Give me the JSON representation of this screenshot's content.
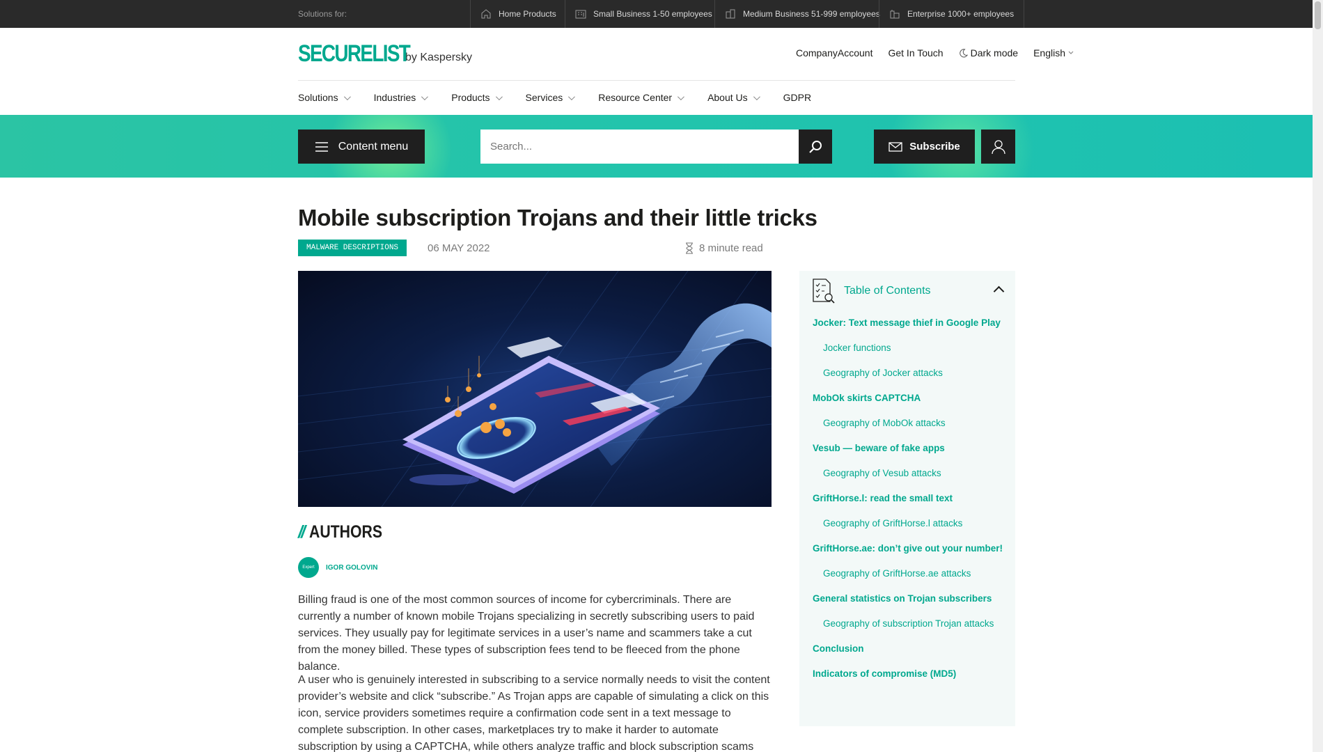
{
  "topbar": {
    "label": "Solutions for:",
    "segments": [
      {
        "label": "Home Products",
        "icon": "home-icon"
      },
      {
        "label": "Small Business 1-50 employees",
        "icon": "building-icon"
      },
      {
        "label": "Medium Business 51-999 employees",
        "icon": "buildings-icon"
      },
      {
        "label": "Enterprise 1000+ employees",
        "icon": "enterprise-icon"
      }
    ]
  },
  "header": {
    "logo_mark": "SECURELIST",
    "logo_by": "by Kaspersky",
    "links": {
      "company_account": "CompanyAccount",
      "get_in_touch": "Get In Touch",
      "dark_mode": "Dark mode",
      "language": "English"
    },
    "nav": [
      "Solutions",
      "Industries",
      "Products",
      "Services",
      "Resource Center",
      "About Us",
      "GDPR"
    ]
  },
  "band": {
    "content_menu": "Content menu",
    "search_placeholder": "Search...",
    "subscribe": "Subscribe"
  },
  "article": {
    "title": "Mobile subscription Trojans and their little tricks",
    "tag": "MALWARE DESCRIPTIONS",
    "date": "06 MAY 2022",
    "read_time": "8 minute read",
    "authors_slashes": "//",
    "authors_heading": "AUTHORS",
    "author_badge": "Expert",
    "author_name": "IGOR GOLOVIN",
    "paragraphs": [
      "Billing fraud is one of the most common sources of income for cybercriminals. There are currently a number of known mobile Trojans specializing in secretly subscribing users to paid services. They usually pay for legitimate services in a user’s name and scammers take a cut from the money billed. These types of subscription fees tend to be fleeced from the phone balance.",
      "A user who is genuinely interested in subscribing to a service normally needs to visit the content provider’s website and click “subscribe.” As Trojan apps are capable of simulating a click on this icon, service providers sometimes require a confirmation code sent in a text message to complete subscription. In other cases, marketplaces try to make it harder to automate subscription by using a CAPTCHA, while others analyze traffic and block subscription scams"
    ]
  },
  "toc": {
    "title": "Table of Contents",
    "items": [
      {
        "label": "Jocker: Text message thief in Google Play",
        "level": 1
      },
      {
        "label": "Jocker functions",
        "level": 2
      },
      {
        "label": "Geography of Jocker attacks",
        "level": 2
      },
      {
        "label": "MobOk skirts CAPTCHA",
        "level": 1
      },
      {
        "label": "Geography of MobOk attacks",
        "level": 2
      },
      {
        "label": "Vesub — beware of fake apps",
        "level": 1
      },
      {
        "label": "Geography of Vesub attacks",
        "level": 2
      },
      {
        "label": "GriftHorse.l: read the small text",
        "level": 1
      },
      {
        "label": "Geography of GriftHorse.l attacks",
        "level": 2
      },
      {
        "label": "GriftHorse.ae: don’t give out your number!",
        "level": 1
      },
      {
        "label": "Geography of GriftHorse.ae attacks",
        "level": 2
      },
      {
        "label": "General statistics on Trojan subscribers",
        "level": 1
      },
      {
        "label": "Geography of subscription Trojan attacks",
        "level": 2
      },
      {
        "label": "Conclusion",
        "level": 1
      },
      {
        "label": "Indicators of compromise (MD5)",
        "level": 1
      }
    ]
  },
  "colors": {
    "accent": "#00a88e",
    "band": "#22c4ac",
    "dark": "#1f1f1f",
    "topbar": "#2a2a2a"
  }
}
